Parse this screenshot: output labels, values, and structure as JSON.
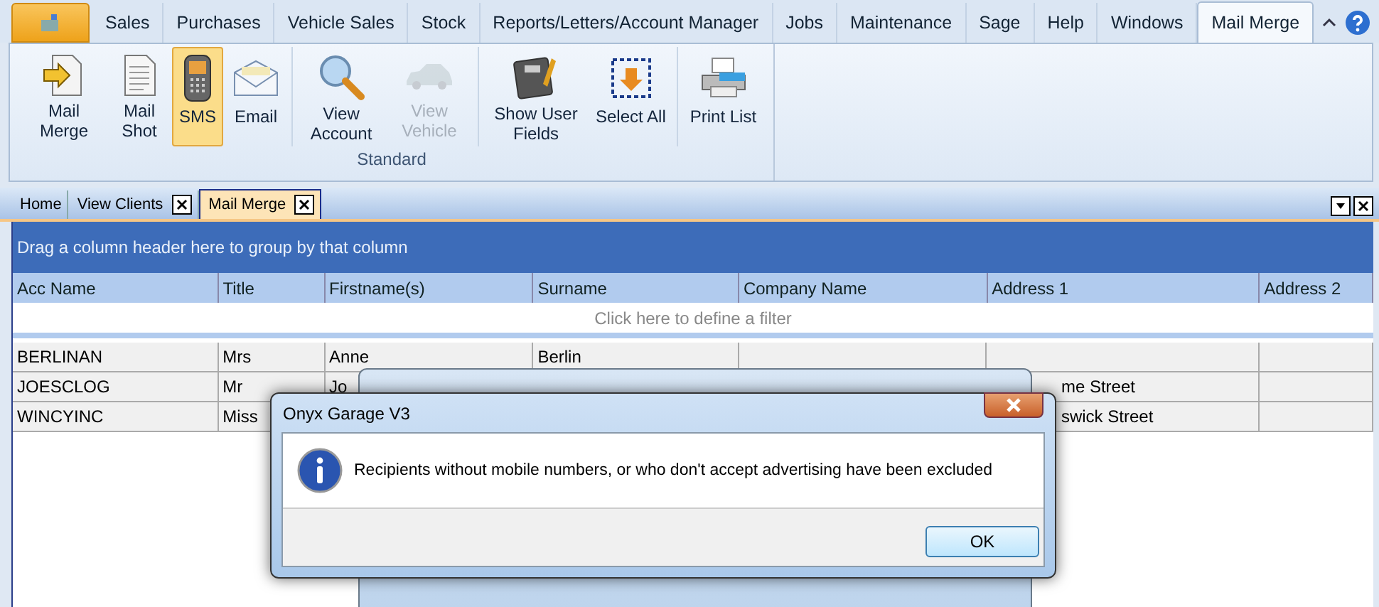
{
  "menu_tabs": [
    {
      "label": "Sales",
      "selected": false
    },
    {
      "label": "Purchases",
      "selected": false
    },
    {
      "label": "Vehicle Sales",
      "selected": false
    },
    {
      "label": "Stock",
      "selected": false
    },
    {
      "label": "Reports/Letters/Account Manager",
      "selected": false
    },
    {
      "label": "Jobs",
      "selected": false
    },
    {
      "label": "Maintenance",
      "selected": false
    },
    {
      "label": "Sage",
      "selected": false
    },
    {
      "label": "Help",
      "selected": false
    },
    {
      "label": "Windows",
      "selected": false
    },
    {
      "label": "Mail Merge",
      "selected": true
    }
  ],
  "ribbon": {
    "group_label": "Standard",
    "sections": [
      [
        {
          "label": "Mail Merge",
          "kind": "merge",
          "selected": false,
          "disabled": false
        },
        {
          "label": "Mail Shot",
          "kind": "document",
          "selected": false,
          "disabled": false
        },
        {
          "label": "SMS",
          "kind": "phone",
          "selected": true,
          "disabled": false
        },
        {
          "label": "Email",
          "kind": "envelope",
          "selected": false,
          "disabled": false
        }
      ],
      [
        {
          "label": "View Account",
          "kind": "magnifier",
          "selected": false,
          "disabled": false
        },
        {
          "label": "View Vehicle",
          "kind": "car",
          "selected": false,
          "disabled": true
        }
      ],
      [
        {
          "label": "Show User Fields",
          "kind": "book",
          "selected": false,
          "disabled": false
        },
        {
          "label": "Select All",
          "kind": "select",
          "selected": false,
          "disabled": false
        }
      ],
      [
        {
          "label": "Print List",
          "kind": "printer",
          "selected": false,
          "disabled": false
        }
      ]
    ]
  },
  "document_tabs": [
    {
      "label": "Home",
      "selected": false,
      "closable": false
    },
    {
      "label": "View Clients",
      "selected": false,
      "closable": true
    },
    {
      "label": "Mail Merge",
      "selected": true,
      "closable": true
    }
  ],
  "grid": {
    "group_panel": "Drag a column header here to group by that column",
    "columns": [
      "Acc Name",
      "Title",
      "Firstname(s)",
      "Surname",
      "Company Name",
      "Address 1",
      "Address 2"
    ],
    "filter_row": "Click here to define a filter",
    "rows": [
      {
        "cells": [
          "BERLINAN",
          "Mrs",
          "Anne",
          "Berlin",
          "",
          "",
          ""
        ]
      },
      {
        "cells": [
          "JOESCLOG",
          "Mr",
          "Jo",
          "",
          "",
          "me Street",
          ""
        ]
      },
      {
        "cells": [
          "WINCYINC",
          "Miss",
          "",
          "",
          "",
          "swick Street",
          ""
        ]
      }
    ]
  },
  "message_dialog": {
    "title": "Onyx Garage V3",
    "message": "Recipients without mobile numbers, or who don't accept advertising have been excluded",
    "button": "OK"
  }
}
